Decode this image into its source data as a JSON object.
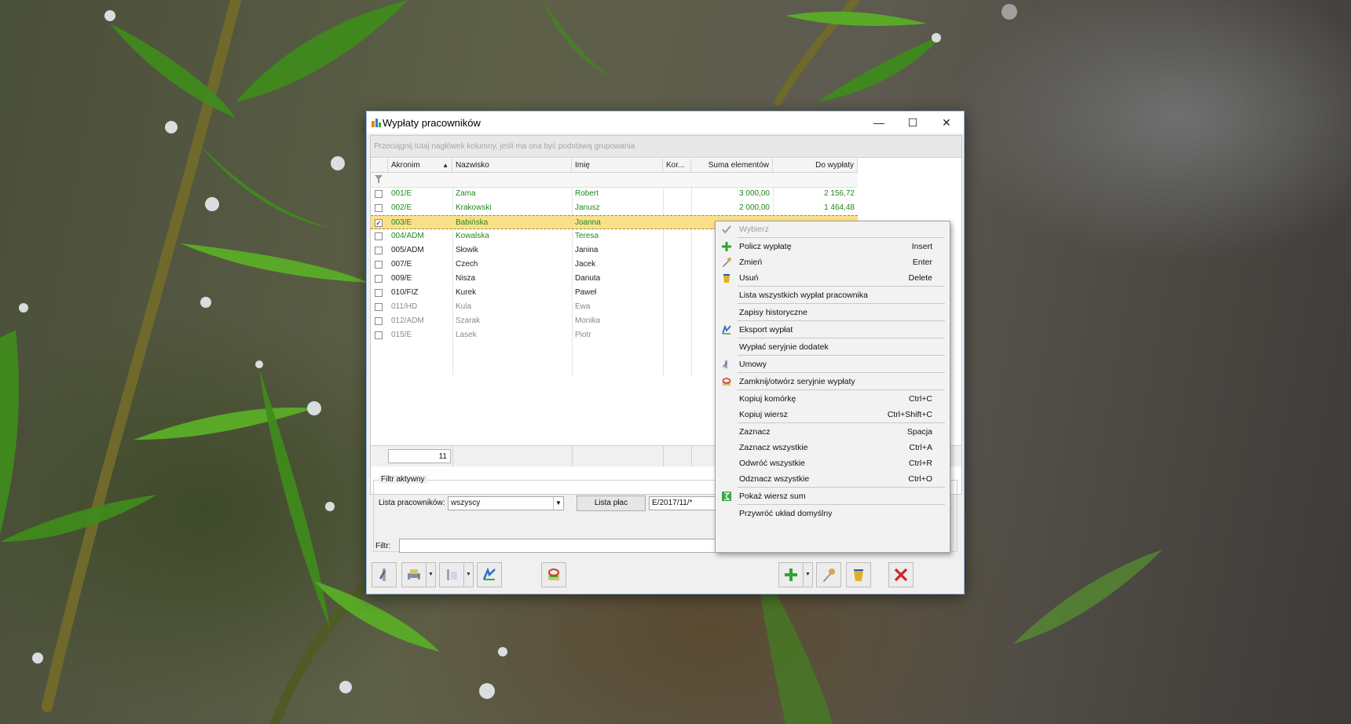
{
  "window": {
    "title": "Wypłaty pracowników",
    "minimize": "—",
    "maximize": "☐",
    "close": "✕"
  },
  "grid": {
    "group_hint": "Przeciągnij tutaj nagłówek kolumny, jeśli ma ona być podstawą grupowania",
    "columns": [
      "Akronim",
      "Nazwisko",
      "Imię",
      "Kor...",
      "Suma elementów",
      "Do wypłaty"
    ],
    "sort_indicator": "▲",
    "rows": [
      {
        "check": "",
        "akronim": "001/E",
        "nazwisko": "Zama",
        "imie": "Robert",
        "suma": "3 000,00",
        "do_wyplaty": "2 156,72",
        "color": "green"
      },
      {
        "check": "",
        "akronim": "002/E",
        "nazwisko": "Krakowski",
        "imie": "Janusz",
        "suma": "2 000,00",
        "do_wyplaty": "1 464,48",
        "color": "green"
      },
      {
        "check": "✓",
        "akronim": "003/E",
        "nazwisko": "Babińska",
        "imie": "Joanna",
        "suma": "",
        "do_wyplaty": "",
        "color": "green"
      },
      {
        "check": "",
        "akronim": "004/ADM",
        "nazwisko": "Kowalska",
        "imie": "Teresa",
        "suma": "",
        "do_wyplaty": "",
        "color": "green"
      },
      {
        "check": "",
        "akronim": "005/ADM",
        "nazwisko": "Słowik",
        "imie": "Janina",
        "suma": "",
        "do_wyplaty": "",
        "color": "black"
      },
      {
        "check": "",
        "akronim": "007/E",
        "nazwisko": "Czech",
        "imie": "Jacek",
        "suma": "",
        "do_wyplaty": "",
        "color": "black"
      },
      {
        "check": "",
        "akronim": "009/E",
        "nazwisko": "Nisza",
        "imie": "Danuta",
        "suma": "",
        "do_wyplaty": "",
        "color": "black"
      },
      {
        "check": "",
        "akronim": "010/FIZ",
        "nazwisko": "Kurek",
        "imie": "Paweł",
        "suma": "",
        "do_wyplaty": "",
        "color": "black"
      },
      {
        "check": "",
        "akronim": "011/HD",
        "nazwisko": "Kula",
        "imie": "Ewa",
        "suma": "",
        "do_wyplaty": "",
        "color": "gray"
      },
      {
        "check": "",
        "akronim": "012/ADM",
        "nazwisko": "Szarak",
        "imie": "Monika",
        "suma": "",
        "do_wyplaty": "",
        "color": "gray"
      },
      {
        "check": "",
        "akronim": "015/E",
        "nazwisko": "Lasek",
        "imie": "Piotr",
        "suma": "",
        "do_wyplaty": "",
        "color": "gray"
      }
    ],
    "footer_count": "11"
  },
  "filter": {
    "legend": "Filtr aktywny",
    "employees_label": "Lista pracowników:",
    "employees_value": "wszyscy",
    "payroll_button": "Lista płac",
    "payroll_value": "E/2017/11/*",
    "filter_label": "Filtr:",
    "filter_value": ""
  },
  "context_menu": {
    "items": [
      {
        "label": "Wybierz",
        "shortcut": "",
        "icon": "check-icon",
        "disabled": true
      },
      {
        "label": "Policz wypłatę",
        "shortcut": "Insert",
        "icon": "plus-icon"
      },
      {
        "label": "Zmień",
        "shortcut": "Enter",
        "icon": "edit-icon"
      },
      {
        "label": "Usuń",
        "shortcut": "Delete",
        "icon": "trash-icon"
      },
      {
        "label": "Lista wszystkich wypłat pracownika",
        "shortcut": "",
        "icon": ""
      },
      {
        "label": "Zapisy historyczne",
        "shortcut": "",
        "icon": ""
      },
      {
        "label": "Eksport wypłat",
        "shortcut": "",
        "icon": "export-icon"
      },
      {
        "label": "Wypłać seryjnie dodatek",
        "shortcut": "",
        "icon": ""
      },
      {
        "label": "Umowy",
        "shortcut": "",
        "icon": "contract-icon"
      },
      {
        "label": "Zamknij/otwórz seryjnie wypłaty",
        "shortcut": "",
        "icon": "lock-icon"
      },
      {
        "label": "Kopiuj komórkę",
        "shortcut": "Ctrl+C",
        "icon": ""
      },
      {
        "label": "Kopiuj wiersz",
        "shortcut": "Ctrl+Shift+C",
        "icon": ""
      },
      {
        "label": "Zaznacz",
        "shortcut": "Spacja",
        "icon": ""
      },
      {
        "label": "Zaznacz wszystkie",
        "shortcut": "Ctrl+A",
        "icon": ""
      },
      {
        "label": "Odwróć wszystkie",
        "shortcut": "Ctrl+R",
        "icon": ""
      },
      {
        "label": "Odznacz wszystkie",
        "shortcut": "Ctrl+O",
        "icon": ""
      },
      {
        "label": "Pokaż wiersz sum",
        "shortcut": "",
        "icon": "sum-icon"
      },
      {
        "label": "Przywróć układ domyślny",
        "shortcut": "",
        "icon": ""
      }
    ]
  },
  "colors": {
    "green_text": "#1f8a1f",
    "selected_row": "#fbe08a",
    "window_border": "#8fb6dc"
  }
}
